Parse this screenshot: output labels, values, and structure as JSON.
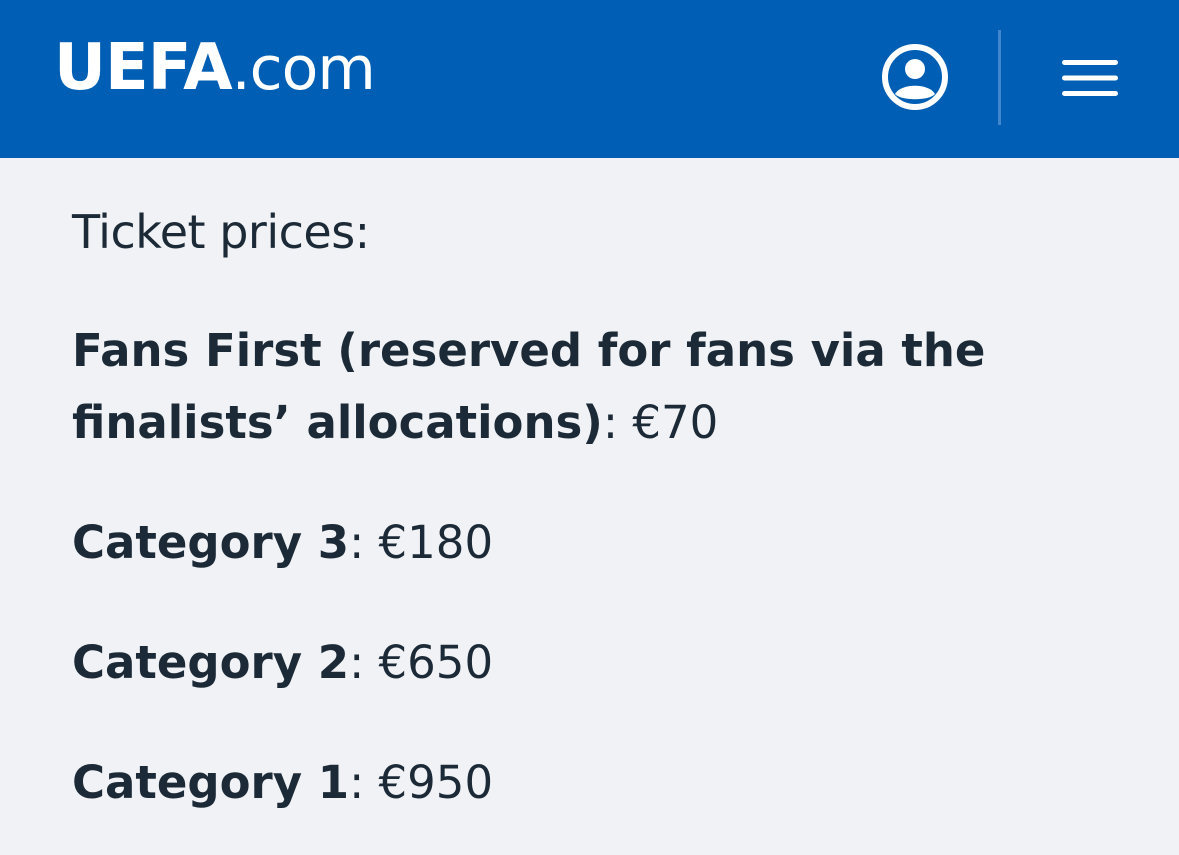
{
  "header": {
    "logo_strong": "UEFA",
    "logo_light": ".com",
    "brand_color": "#005fb5",
    "account_icon": "user-circle-icon",
    "menu_icon": "hamburger-menu-icon"
  },
  "content": {
    "intro": "Ticket prices:",
    "prices": [
      {
        "label": "Fans First (reserved for fans via the finalists’ allocations)",
        "separator": ":",
        "value": "€70"
      },
      {
        "label": "Category 3",
        "separator": ":",
        "value": "€180"
      },
      {
        "label": "Category 2",
        "separator": ":",
        "value": "€650"
      },
      {
        "label": "Category 1",
        "separator": ":",
        "value": "€950"
      }
    ]
  }
}
